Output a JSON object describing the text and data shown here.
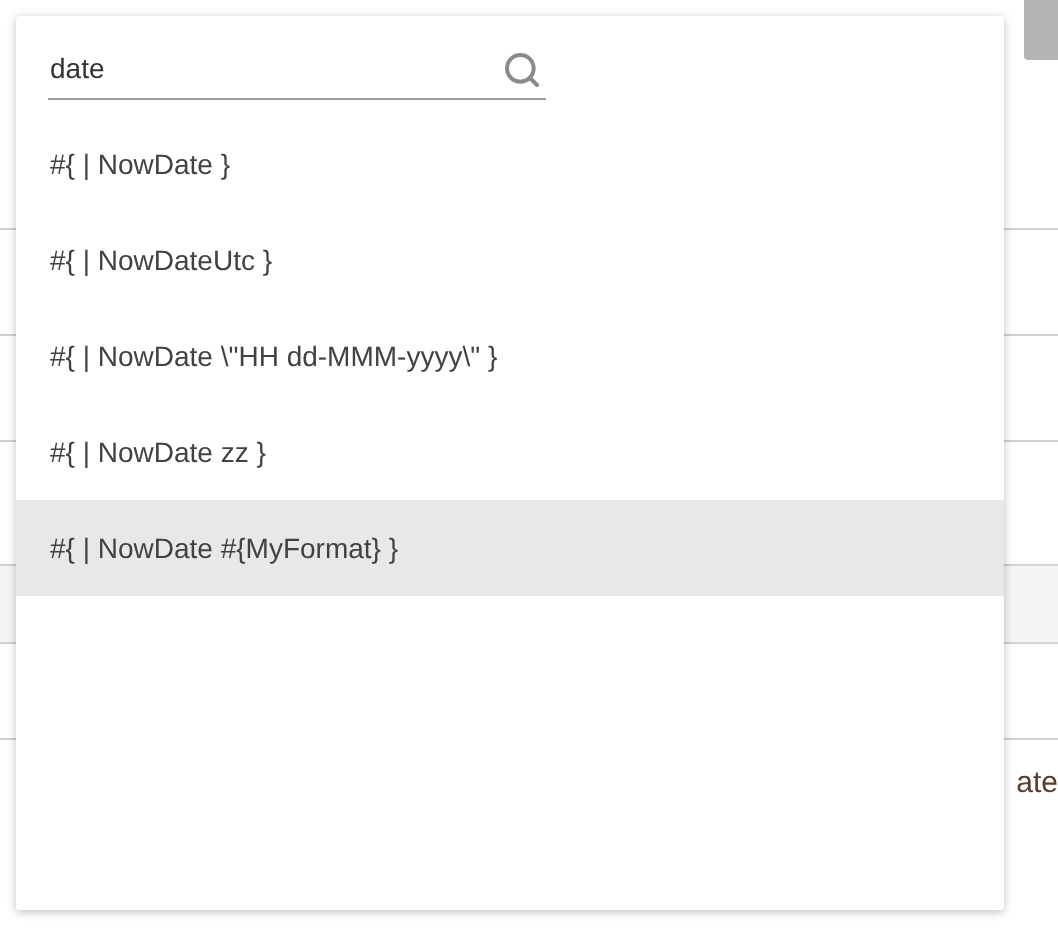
{
  "background": {
    "right_column": [
      "ate"
    ]
  },
  "search": {
    "value": "date"
  },
  "suggestions": [
    {
      "text": "#{ | NowDate }",
      "selected": false
    },
    {
      "text": "#{ | NowDateUtc }",
      "selected": false
    },
    {
      "text": "#{ | NowDate \\\"HH dd-MMM-yyyy\\\" }",
      "selected": false
    },
    {
      "text": "#{ | NowDate zz }",
      "selected": false
    },
    {
      "text": "#{ | NowDate #{MyFormat} }",
      "selected": true
    }
  ]
}
